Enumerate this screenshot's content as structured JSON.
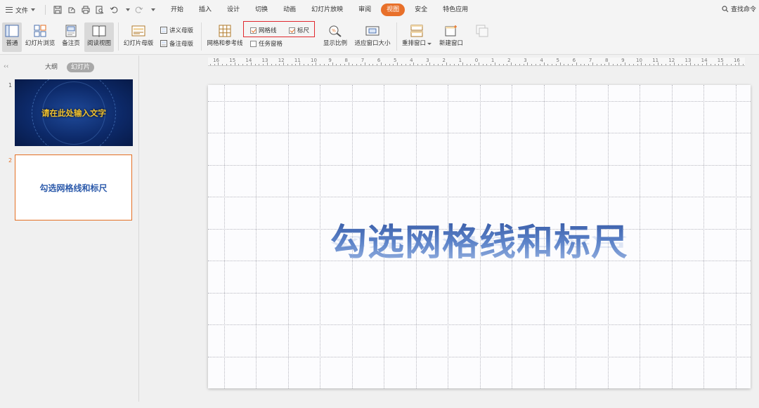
{
  "menubar": {
    "file_label": "文件",
    "tabs": [
      "开始",
      "插入",
      "设计",
      "切换",
      "动画",
      "幻灯片放映",
      "审阅",
      "视图",
      "安全",
      "特色应用"
    ],
    "active_tab": "视图",
    "search_label": "查找命令"
  },
  "ribbon": {
    "normal": "普通",
    "slide_browse": "幻灯片浏览",
    "notes_page": "备注页",
    "reading_view": "阅读视图",
    "slide_master": "幻灯片母版",
    "handout_master": "讲义母版",
    "notes_master": "备注母版",
    "grid_guides": "网格和参考线",
    "gridlines": "网格线",
    "ruler": "标尺",
    "task_pane": "任务窗格",
    "zoom": "显示比例",
    "fit_window": "适应窗口大小",
    "arrange": "重排窗口",
    "new_window": "新建窗口",
    "gridlines_checked": true,
    "ruler_checked": true,
    "task_pane_checked": false
  },
  "left_panel": {
    "tab_outline": "大纲",
    "tab_slides": "幻灯片",
    "slide1_number": "1",
    "slide1_title": "请在此处输入文字",
    "slide2_number": "2",
    "slide2_title": "勾选网格线和标尺"
  },
  "ruler": {
    "labels": [
      "16",
      "15",
      "14",
      "13",
      "12",
      "11",
      "10",
      "9",
      "8",
      "7",
      "6",
      "5",
      "4",
      "3",
      "2",
      "1",
      "0",
      "1",
      "2",
      "3",
      "4",
      "5",
      "6",
      "7",
      "8",
      "9",
      "10",
      "11",
      "12",
      "13",
      "14",
      "15",
      "16"
    ]
  },
  "slide": {
    "title": "勾选网格线和标尺"
  },
  "colors": {
    "accent": "#e8702a",
    "highlight_box": "#e0282e",
    "title_blue": "#3a62b0"
  }
}
